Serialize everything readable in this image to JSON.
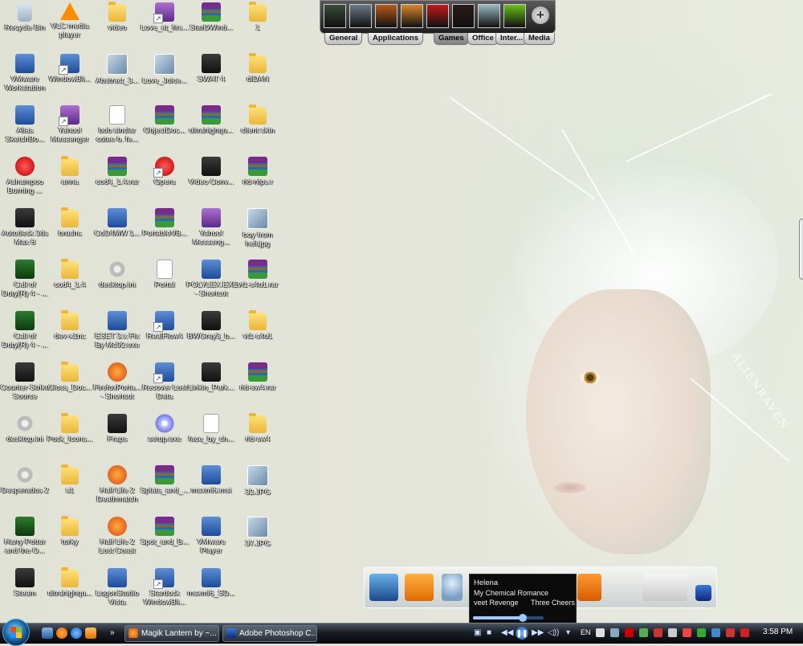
{
  "desktop": {
    "icons": [
      {
        "label": "Recycle Bin",
        "glyph": "bin"
      },
      {
        "label": "VLC media player",
        "glyph": "cone"
      },
      {
        "label": "video",
        "glyph": "folder"
      },
      {
        "label": "Love_at_firs...",
        "glyph": "purple"
      },
      {
        "label": "StarDWind...",
        "glyph": "rar"
      },
      {
        "label": "1",
        "glyph": "folder"
      },
      {
        "label": "VMware Workstation",
        "glyph": "app"
      },
      {
        "label": "WindowBli...",
        "glyph": "app"
      },
      {
        "label": "Abstract_3...",
        "glyph": "photo"
      },
      {
        "label": "Love_Juice...",
        "glyph": "photo"
      },
      {
        "label": "SWAT 4",
        "glyph": "dark"
      },
      {
        "label": "diDAN",
        "glyph": "folder"
      },
      {
        "label": "Alias SketchBo...",
        "glyph": "app"
      },
      {
        "label": "Yahoo! Messenger",
        "glyph": "purple"
      },
      {
        "label": "bob sinclar cutee b. fe...",
        "glyph": "doc"
      },
      {
        "label": "ObjectDoc...",
        "glyph": "rar"
      },
      {
        "label": "ultrahighqu...",
        "glyph": "rar"
      },
      {
        "label": "client skin",
        "glyph": "folder"
      },
      {
        "label": "Ashampoo Burning ...",
        "glyph": "red"
      },
      {
        "label": "anna",
        "glyph": "folder"
      },
      {
        "label": "cod4_1.4.rar",
        "glyph": "rar"
      },
      {
        "label": "Opera",
        "glyph": "red"
      },
      {
        "label": "Video Conv...",
        "glyph": "dark"
      },
      {
        "label": "rld-nfps.r",
        "glyph": "rar"
      },
      {
        "label": "Autodesk 3ds Max 8",
        "glyph": "dark"
      },
      {
        "label": "brushs",
        "glyph": "folder"
      },
      {
        "label": "CoD4MW 1...",
        "glyph": "app"
      },
      {
        "label": "PortableVB...",
        "glyph": "rar"
      },
      {
        "label": "Yahoo! Messeng...",
        "glyph": "purple"
      },
      {
        "label": "boy from hell.jpg",
        "glyph": "photo"
      },
      {
        "label": "Call of Duty(R) 4 - ...",
        "glyph": "green"
      },
      {
        "label": "cod4_1.4",
        "glyph": "folder"
      },
      {
        "label": "desktop.ini",
        "glyph": "gear"
      },
      {
        "label": "Portal",
        "glyph": "doc"
      },
      {
        "label": "POLYLEX.EXE - Shortcut",
        "glyph": "app"
      },
      {
        "label": "vt1-s4u1.rar",
        "glyph": "rar"
      },
      {
        "label": "Call of Duty(R) 4 - ...",
        "glyph": "green"
      },
      {
        "label": "dev-x1nc",
        "glyph": "folder"
      },
      {
        "label": "ESET 3.x Fix By Mc92.exe",
        "glyph": "app"
      },
      {
        "label": "RealFlow4",
        "glyph": "app"
      },
      {
        "label": "BWGrey3_b...",
        "glyph": "dark"
      },
      {
        "label": "vt1-s4u1",
        "glyph": "folder"
      },
      {
        "label": "Counter-Strike Source",
        "glyph": "dark"
      },
      {
        "label": "Gloss_Doc...",
        "glyph": "folder"
      },
      {
        "label": "FirefoxPorta... - Shortcut",
        "glyph": "orange"
      },
      {
        "label": "Recover Lost Data",
        "glyph": "app"
      },
      {
        "label": "Linkin_Park...",
        "glyph": "dark"
      },
      {
        "label": "rld-sw4.rar",
        "glyph": "rar"
      },
      {
        "label": "desktop.ini",
        "glyph": "gear"
      },
      {
        "label": "Puck_Icons...",
        "glyph": "folder"
      },
      {
        "label": "Fraps",
        "glyph": "dark"
      },
      {
        "label": "setup.exe",
        "glyph": "cd"
      },
      {
        "label": "face_by_ch...",
        "glyph": "doc"
      },
      {
        "label": "rld-sw4",
        "glyph": "folder"
      },
      {
        "label": "Desperados 2",
        "glyph": "gear"
      },
      {
        "label": "s1",
        "glyph": "folder"
      },
      {
        "label": "Half Life 2 Deathmatch",
        "glyph": "orange"
      },
      {
        "label": "Splats_and_...",
        "glyph": "rar"
      },
      {
        "label": "msxml6.msi",
        "glyph": "app"
      },
      {
        "label": "32.JPG",
        "glyph": "photo"
      },
      {
        "label": "Harry Potter and the O...",
        "glyph": "green"
      },
      {
        "label": "turky",
        "glyph": "folder"
      },
      {
        "label": "Half Life 2 Lost Coast",
        "glyph": "orange"
      },
      {
        "label": "Spot_and_B...",
        "glyph": "rar"
      },
      {
        "label": "VMware Player",
        "glyph": "app"
      },
      {
        "label": "37.JPG",
        "glyph": "photo"
      },
      {
        "label": "Steam",
        "glyph": "dark"
      },
      {
        "label": "ultrahighqu...",
        "glyph": "folder"
      },
      {
        "label": "LogonStudio Vista",
        "glyph": "app"
      },
      {
        "label": "Stardock WindowBli...",
        "glyph": "app"
      },
      {
        "label": "msxml6_SD...",
        "glyph": "app"
      }
    ]
  },
  "top_dock": {
    "items": [
      {
        "name": "game-icon-1",
        "color": "#3a4a3a"
      },
      {
        "name": "game-icon-2",
        "color": "#6a7a8a"
      },
      {
        "name": "game-icon-3",
        "color": "#b85a1a"
      },
      {
        "name": "game-icon-4",
        "color": "#d8882a"
      },
      {
        "name": "gears-of-war-icon",
        "color": "#c01a1a"
      },
      {
        "name": "hitman-icon",
        "color": "#2a1a1a"
      },
      {
        "name": "game-icon-7",
        "color": "#9ab8c0"
      },
      {
        "name": "game-icon-8",
        "color": "#6ac01a"
      }
    ],
    "tabs": [
      "General",
      "Applications",
      "Games",
      "Office",
      "Inter...",
      "Media"
    ],
    "active_tab": "Games"
  },
  "media_popup": {
    "title": "Helena",
    "artist": "My Chemical Romance",
    "album": "veet Revenge",
    "album_right": "Three Cheers",
    "progress": 0.7
  },
  "taskbar": {
    "buttons": [
      {
        "label": "Magik Lantern by ~..."
      },
      {
        "label": "Adobe Photoshop C..."
      }
    ],
    "overflow": "»",
    "language": "EN",
    "clock": "3:58 PM"
  },
  "wallpaper": {
    "signature": "ALIENRAVEN"
  },
  "colors": {
    "taskbar": "#1a1e24",
    "icon_text": "#ffffff"
  }
}
